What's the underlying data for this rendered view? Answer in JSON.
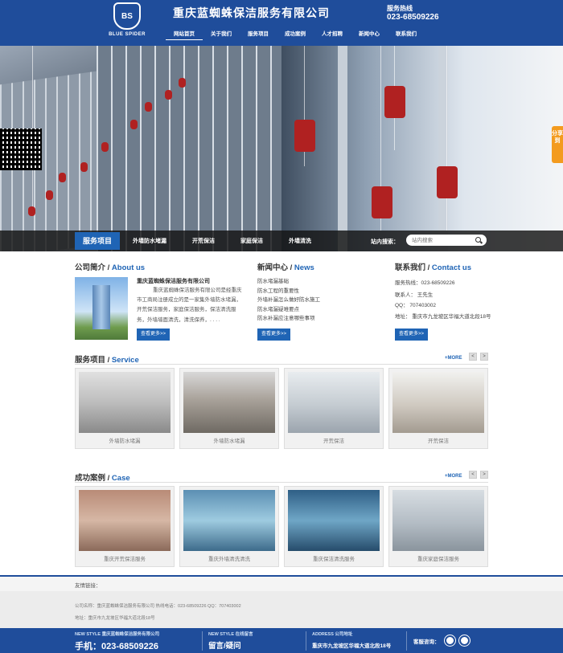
{
  "header": {
    "logo_text": "BLUE SPIDER",
    "logo_mark": "BS",
    "company_name": "重庆蓝蜘蛛保洁服务有限公司",
    "hotline_label": "服务热线",
    "hotline": "023-68509226",
    "nav": [
      "网站首页",
      "关于我们",
      "服务项目",
      "成功案例",
      "人才招聘",
      "新闻中心",
      "联系我们"
    ]
  },
  "banner": {
    "share_label": "分享到"
  },
  "service_bar": {
    "title": "服务项目",
    "links": [
      "外墙防水堵漏",
      "开荒保洁",
      "家庭保洁",
      "外墙清洗"
    ],
    "search_label": "站内搜索：",
    "search_placeholder": "站内搜索"
  },
  "about": {
    "heading_cn": "公司简介 / ",
    "heading_en": "About us",
    "company": "重庆蓝蜘蛛保洁服务有限公司",
    "text": "重庆蓝蜘蛛保洁服务有限公司是经重庆市工商局注册成立的是一家集外墙防水堵漏，开荒保洁服务，家庭保洁服务，保洁清洗服务，外墙墙面清洗，清洗保养，. . . .",
    "more": "查看更多>>"
  },
  "news": {
    "heading_cn": "新闻中心 / ",
    "heading_en": "News",
    "items": [
      "防水堵漏基础",
      "防水工程的重要性",
      "外墙补漏怎么做好防水施工",
      "防水堵漏疑难要点",
      "防水补漏应注意哪些事项"
    ],
    "more": "查看更多>>"
  },
  "contact": {
    "heading_cn": "联系我们 / ",
    "heading_en": "Contact us",
    "rows": [
      "服务热线：023-68509226",
      "联系人：  王先生",
      "QQ：  707403002",
      "地址：  重庆市九龙坡区华福大道北段18号"
    ],
    "more": "查看更多>>"
  },
  "services": {
    "heading_cn": "服务项目 / ",
    "heading_en": "Service",
    "more": "+MORE",
    "prev": "<",
    "next": ">",
    "cards": [
      "外墙防水堵漏",
      "外墙防水堵漏",
      "开荒保洁",
      "开荒保洁"
    ]
  },
  "cases": {
    "heading_cn": "成功案例 / ",
    "heading_en": "Case",
    "more": "+MORE",
    "prev": "<",
    "next": ">",
    "cards": [
      "重庆开荒保洁服务",
      "重庆外墙清洗清洗",
      "重庆保洁清洗服务",
      "重庆家庭保洁服务"
    ]
  },
  "footer": {
    "links_label": "友情链接：",
    "info_line1": "公司名称：重庆蓝蜘蛛保洁服务有限公司  热线电话：023-68509226  QQ：707403002",
    "info_line2": "地址：重庆市九龙坡区华福大道北段18号",
    "col1_small": "NEW STYLE  重庆蓝蜘蛛保洁服务有限公司",
    "col1_big": "手机：023-68509226",
    "col2_small": "NEW STYLE  在线留言",
    "col2_big": "留言/疑问",
    "col3_small": "ADDRESS  公司地址",
    "col3_mid": "重庆市九龙坡区华福大道北段18号",
    "col4_label": "客服咨询："
  },
  "colors": {
    "brand_blue": "#1f4d9b",
    "accent_blue": "#1f64b5",
    "share_orange": "#f39b1f"
  }
}
